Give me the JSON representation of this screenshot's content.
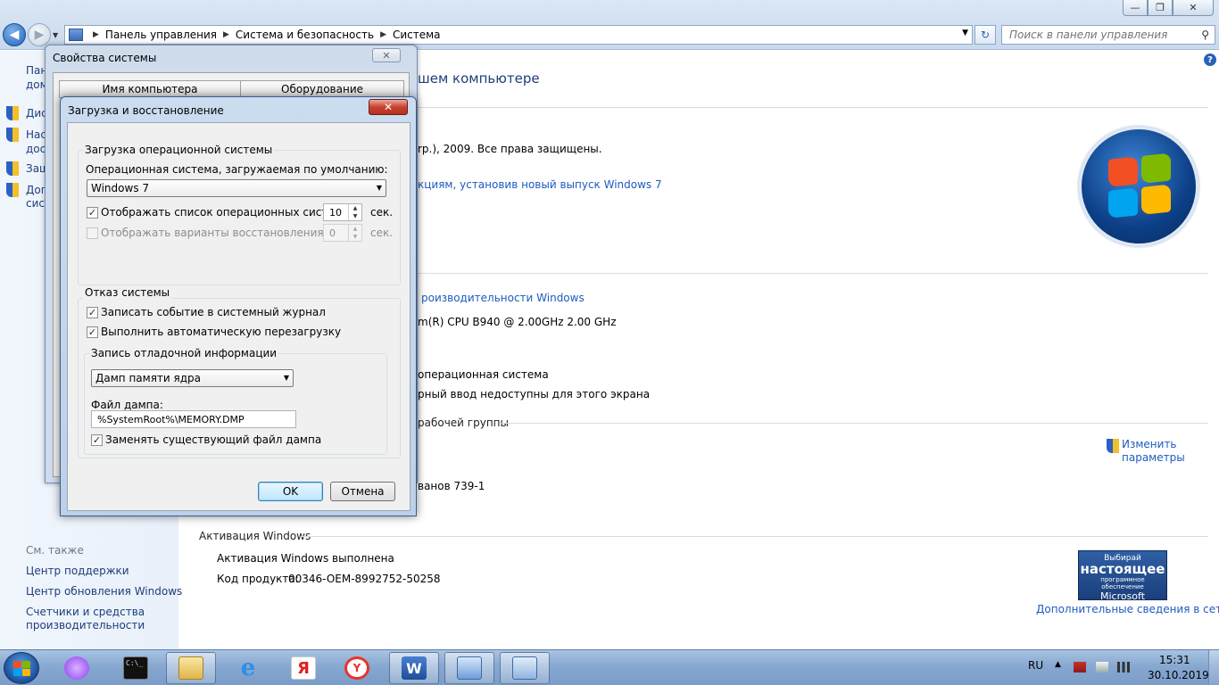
{
  "window": {
    "breadcrumb": [
      "Панель управления",
      "Система и безопасность",
      "Система"
    ],
    "search_placeholder": "Поиск в панели управления",
    "caption_min": "—",
    "caption_max": "❐",
    "caption_close": "✕"
  },
  "left_pane": {
    "items": [
      "Пан",
      "дом",
      "Дис",
      "Нас",
      "дост",
      "Защ",
      "Доп",
      "сист"
    ],
    "see_also": "См. также",
    "links": [
      "Центр поддержки",
      "Центр обновления Windows",
      "Счетчики и средства",
      "производительности"
    ]
  },
  "content": {
    "heading_fragment": "шем компьютере",
    "copyright_fragment": "rp.), 2009. Все права защищены.",
    "upgrade_link_fragment": "кциям, установив новый выпуск Windows 7",
    "perf_link_fragment": "роизводительности Windows",
    "cpu_fragment": "m(R) CPU B940 @ 2.00GHz   2.00 GHz",
    "os_fragment": "операционная система",
    "pen_fragment": "рный ввод недоступны для этого экрана",
    "workgroup_fragment": "рабочей группы",
    "change_settings": [
      "Изменить",
      "параметры"
    ],
    "computer_fragment": "ванов 739-1",
    "activation_head": "Активация Windows",
    "activation_status": "Активация Windows выполнена",
    "product_key_label": "Код продукта:",
    "product_key": "00346-OEM-8992752-50258",
    "more_info_link": "Дополнительные сведения в сети...",
    "genuine_badge": [
      "Выбирай",
      "настоящее",
      "программное обеспечение",
      "Microsoft"
    ]
  },
  "sysprops": {
    "title": "Свойства системы",
    "tabs": [
      "Имя компьютера",
      "Оборудование"
    ]
  },
  "dialog": {
    "title": "Загрузка и восстановление",
    "close": "✕",
    "boot_group": "Загрузка операционной системы",
    "default_os_label": "Операционная система, загружаемая по умолчанию:",
    "default_os_value": "Windows 7",
    "show_os_list_label": "Отображать список операционных систем:",
    "show_os_list_checked": true,
    "show_os_list_seconds": "10",
    "show_recovery_label": "Отображать варианты восстановления:",
    "show_recovery_checked": false,
    "show_recovery_seconds": "0",
    "sec": "сек.",
    "failure_group": "Отказ системы",
    "write_event_label": "Записать событие в системный журнал",
    "auto_restart_label": "Выполнить автоматическую перезагрузку",
    "debug_group": "Запись отладочной информации",
    "debug_type": "Дамп памяти ядра",
    "dump_file_label": "Файл дампа:",
    "dump_file_value": "%SystemRoot%\\MEMORY.DMP",
    "overwrite_label": "Заменять существующий файл дампа",
    "ok": "OK",
    "cancel": "Отмена"
  },
  "taskbar": {
    "lang": "RU",
    "time": "15:31",
    "date": "30.10.2019"
  }
}
